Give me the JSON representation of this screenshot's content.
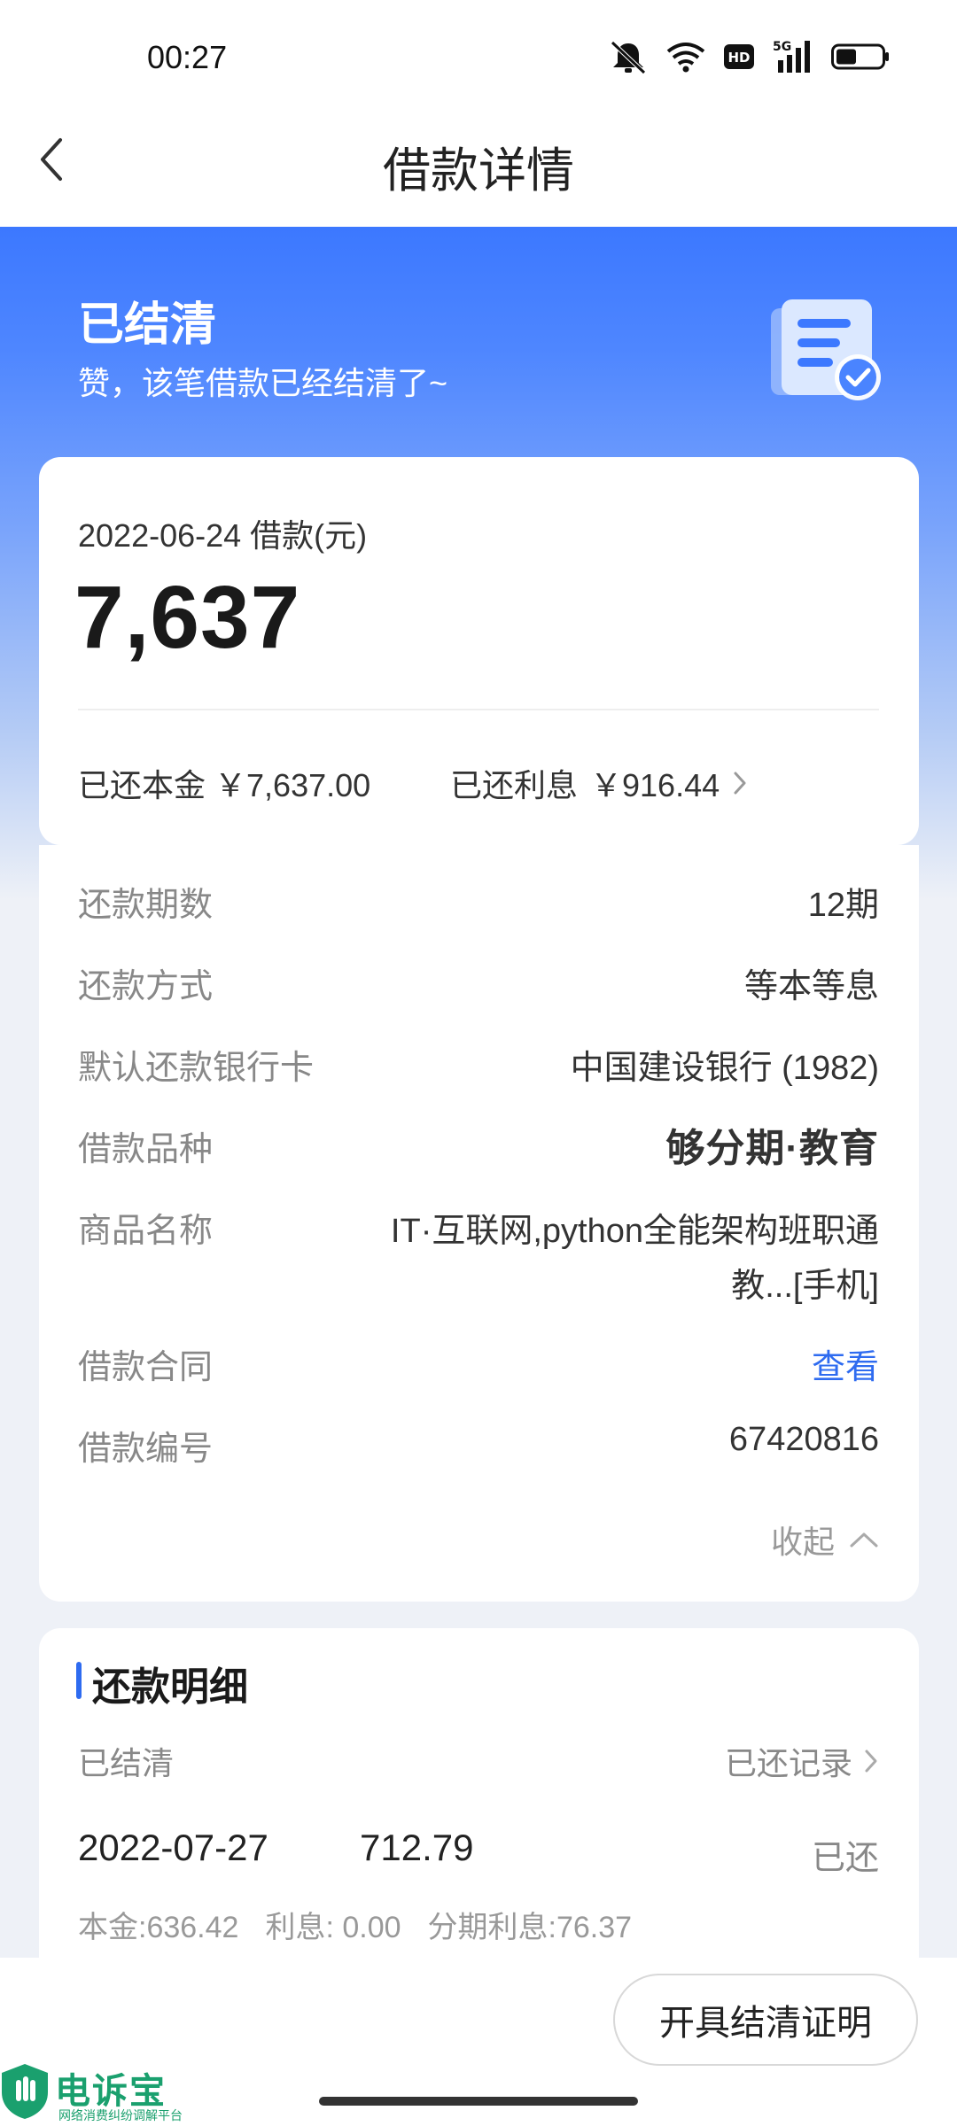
{
  "status_bar": {
    "time": "00:27",
    "icons": [
      "mute-icon",
      "wifi-icon",
      "hd-icon",
      "signal-5g-icon",
      "battery-icon"
    ],
    "hd_label": "HD",
    "network_label": "5G"
  },
  "header": {
    "title": "借款详情",
    "back_icon": "chevron-left-icon"
  },
  "hero": {
    "status": "已结清",
    "message": "赞，该笔借款已经结清了~",
    "icon": "document-check-icon"
  },
  "summary": {
    "date_label": "2022-06-24 借款(元)",
    "amount": "7,637",
    "principal_label": "已还本金",
    "principal_value": "￥7,637.00",
    "interest_label": "已还利息",
    "interest_value": "￥916.44"
  },
  "details": {
    "rows": [
      {
        "label": "还款期数",
        "value": "12期"
      },
      {
        "label": "还款方式",
        "value": "等本等息"
      },
      {
        "label": "默认还款银行卡",
        "value": "中国建设银行 (1982)"
      },
      {
        "label": "借款品种",
        "value": "够分期·教育"
      },
      {
        "label": "商品名称",
        "value_line1": "IT·互联网,python全能架构班职通",
        "value_line2": "教...[手机]"
      },
      {
        "label": "借款合同",
        "value": "查看"
      },
      {
        "label": "借款编号",
        "value": "67420816"
      }
    ],
    "collapse_label": "收起"
  },
  "repayment": {
    "title": "还款明细",
    "status": "已结清",
    "history_label": "已还记录",
    "items": [
      {
        "date": "2022-07-27",
        "amount": "712.79",
        "state": "已还",
        "principal": "本金:636.42",
        "interest": "利息: 0.00",
        "installment_interest": "分期利息:76.37"
      }
    ]
  },
  "footer": {
    "certificate_button": "开具结清证明"
  },
  "watermark": {
    "name": "电诉宝",
    "subtitle": "网络消费纠纷调解平台"
  },
  "colors": {
    "accent": "#2e6bf0",
    "hero_blue": "#3c78ff",
    "watermark_green": "#1aa06e"
  }
}
